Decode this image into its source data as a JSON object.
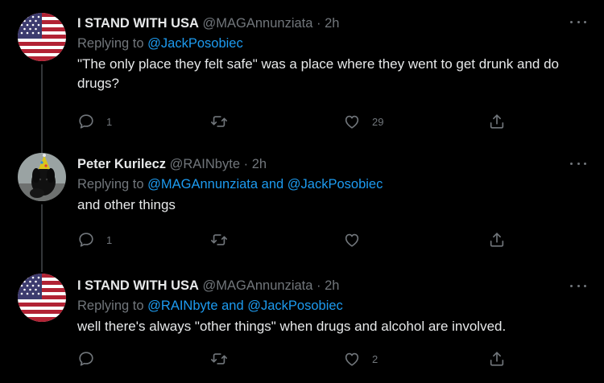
{
  "colors": {
    "background": "#000000",
    "text": "#e7e9ea",
    "muted": "#71767b",
    "link": "#1d9bf0",
    "thread_line": "#333639"
  },
  "tweets": [
    {
      "display_name": "I STAND WITH USA",
      "handle": "@MAGAnnunziata",
      "separator": "·",
      "time": "2h",
      "replying_prefix": "Replying to",
      "mentions": [
        "@JackPosobiec"
      ],
      "mention_joiner": "",
      "text": "\"The only place they felt safe\" was a place where they went to get drunk and do drugs?",
      "avatar": "us-flag-avatar",
      "reply_count": "1",
      "retweet_count": "",
      "like_count": "29"
    },
    {
      "display_name": "Peter Kurilecz",
      "handle": "@RAINbyte",
      "separator": "·",
      "time": "2h",
      "replying_prefix": "Replying to",
      "mentions": [
        "@MAGAnnunziata",
        "@JackPosobiec"
      ],
      "mention_joiner": "and",
      "text": "and other things",
      "avatar": "dog-party-hat-avatar",
      "reply_count": "1",
      "retweet_count": "",
      "like_count": ""
    },
    {
      "display_name": "I STAND WITH USA",
      "handle": "@MAGAnnunziata",
      "separator": "·",
      "time": "2h",
      "replying_prefix": "Replying to",
      "mentions": [
        "@RAINbyte",
        "@JackPosobiec"
      ],
      "mention_joiner": "and",
      "text": "well there's always \"other things\" when drugs and alcohol are involved.",
      "avatar": "us-flag-avatar",
      "reply_count": "",
      "retweet_count": "",
      "like_count": "2"
    }
  ]
}
